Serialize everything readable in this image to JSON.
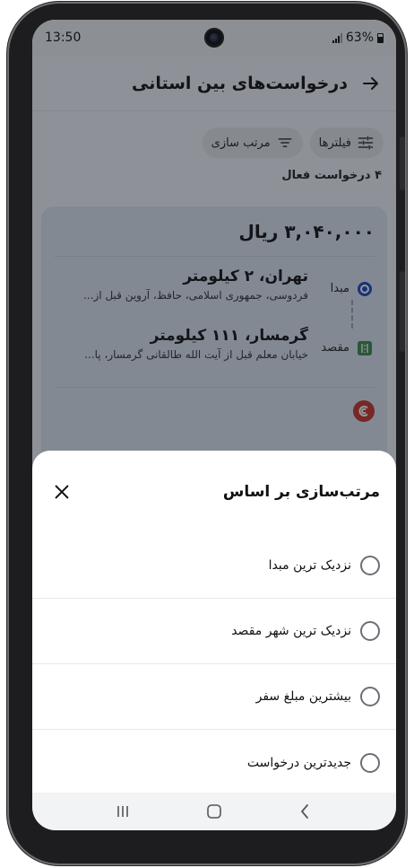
{
  "status_bar": {
    "time": "13:50",
    "battery_text": "63%"
  },
  "header": {
    "title": "درخواست‌های بین استانی",
    "back_icon": "arrow-right-icon"
  },
  "filters": {
    "filters_label": "فیلترها",
    "sort_label": "مرتب سازی"
  },
  "requests_count_text": "۴ درخواست فعال",
  "card": {
    "price": "۳,۰۴۰,۰۰۰ ریال",
    "origin": {
      "label": "مبدا",
      "title": "تهران، ۲ کیلومتر",
      "address": "فردوسی، جمهوری اسلامی، حافظ، آروین قبل از..."
    },
    "destination": {
      "label": "مقصد",
      "title": "گرمسار، ۱۱۱ کیلومتر",
      "address": "خیابان معلم قبل از آیت الله طالقانی گرمسار، پا..."
    },
    "provider_icon": "provider-logo-icon"
  },
  "sort_sheet": {
    "title": "مرتب‌سازی بر اساس",
    "options": [
      {
        "label": "نزدیک ترین مبدا",
        "selected": false
      },
      {
        "label": "نزدیک ترین شهر مقصد",
        "selected": false
      },
      {
        "label": "بیشترین مبلغ سفر",
        "selected": false
      },
      {
        "label": "جدیدترین درخواست",
        "selected": false
      }
    ]
  },
  "colors": {
    "accent": "#1b3aa6",
    "card_bg": "#dde6f3",
    "overlay": "#141820"
  }
}
